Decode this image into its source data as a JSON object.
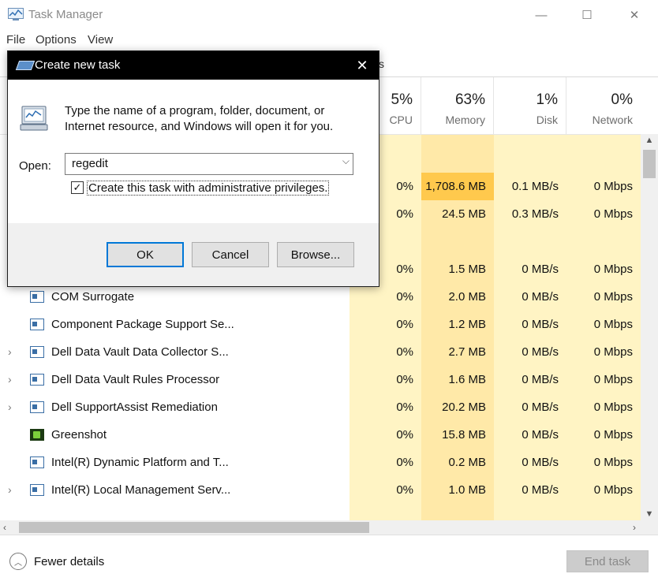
{
  "window": {
    "title": "Task Manager",
    "controls": {
      "minimize": "—",
      "maximize": "☐",
      "close": "✕"
    }
  },
  "menu": [
    {
      "label": "File"
    },
    {
      "label": "Options"
    },
    {
      "label": "View"
    }
  ],
  "tab_peek": "s",
  "columns": [
    {
      "percent": "5%",
      "name": "CPU"
    },
    {
      "percent": "63%",
      "name": "Memory"
    },
    {
      "percent": "1%",
      "name": "Disk"
    },
    {
      "percent": "0%",
      "name": "Network"
    }
  ],
  "rows": [
    {
      "name": "",
      "expander": "",
      "icon": "none",
      "cpu": "",
      "memory": "",
      "disk": "",
      "network": ""
    },
    {
      "name": "",
      "expander": "",
      "icon": "none",
      "cpu": "0%",
      "memory": "1,708.6 MB",
      "disk": "0.1 MB/s",
      "network": "0 Mbps"
    },
    {
      "name": "",
      "expander": "",
      "icon": "none",
      "cpu": "0%",
      "memory": "24.5 MB",
      "disk": "0.3 MB/s",
      "network": "0 Mbps"
    },
    {
      "name": "",
      "expander": "",
      "icon": "none",
      "cpu": "",
      "memory": "",
      "disk": "",
      "network": ""
    },
    {
      "name": "",
      "expander": "",
      "icon": "none",
      "cpu": "0%",
      "memory": "1.5 MB",
      "disk": "0 MB/s",
      "network": "0 Mbps"
    },
    {
      "name": "COM Surrogate",
      "expander": "",
      "icon": "app",
      "cpu": "0%",
      "memory": "2.0 MB",
      "disk": "0 MB/s",
      "network": "0 Mbps"
    },
    {
      "name": "Component Package Support Se...",
      "expander": "",
      "icon": "app",
      "cpu": "0%",
      "memory": "1.2 MB",
      "disk": "0 MB/s",
      "network": "0 Mbps"
    },
    {
      "name": "Dell Data Vault Data Collector S...",
      "expander": "›",
      "icon": "app",
      "cpu": "0%",
      "memory": "2.7 MB",
      "disk": "0 MB/s",
      "network": "0 Mbps"
    },
    {
      "name": "Dell Data Vault Rules Processor",
      "expander": "›",
      "icon": "app",
      "cpu": "0%",
      "memory": "1.6 MB",
      "disk": "0 MB/s",
      "network": "0 Mbps"
    },
    {
      "name": "Dell SupportAssist Remediation",
      "expander": "›",
      "icon": "app",
      "cpu": "0%",
      "memory": "20.2 MB",
      "disk": "0 MB/s",
      "network": "0 Mbps"
    },
    {
      "name": "Greenshot",
      "expander": "",
      "icon": "greenshot",
      "cpu": "0%",
      "memory": "15.8 MB",
      "disk": "0 MB/s",
      "network": "0 Mbps"
    },
    {
      "name": "Intel(R) Dynamic Platform and T...",
      "expander": "",
      "icon": "app",
      "cpu": "0%",
      "memory": "0.2 MB",
      "disk": "0 MB/s",
      "network": "0 Mbps"
    },
    {
      "name": "Intel(R) Local Management Serv...",
      "expander": "›",
      "icon": "app",
      "cpu": "0%",
      "memory": "1.0 MB",
      "disk": "0 MB/s",
      "network": "0 Mbps"
    }
  ],
  "colors": {
    "light_shade": "#fff4c4",
    "mid_shade": "#ffe9a8",
    "hot_memory": "#ffc94d"
  },
  "footer": {
    "fewer_details": "Fewer details",
    "end_task": "End task"
  },
  "dialog": {
    "title": "Create new task",
    "description": "Type the name of a program, folder, document, or Internet resource, and Windows will open it for you.",
    "open_label": "Open:",
    "open_value": "regedit",
    "admin_checkbox_label": "Create this task with administrative privileges.",
    "admin_checked": true,
    "ok": "OK",
    "cancel": "Cancel",
    "browse": "Browse..."
  }
}
